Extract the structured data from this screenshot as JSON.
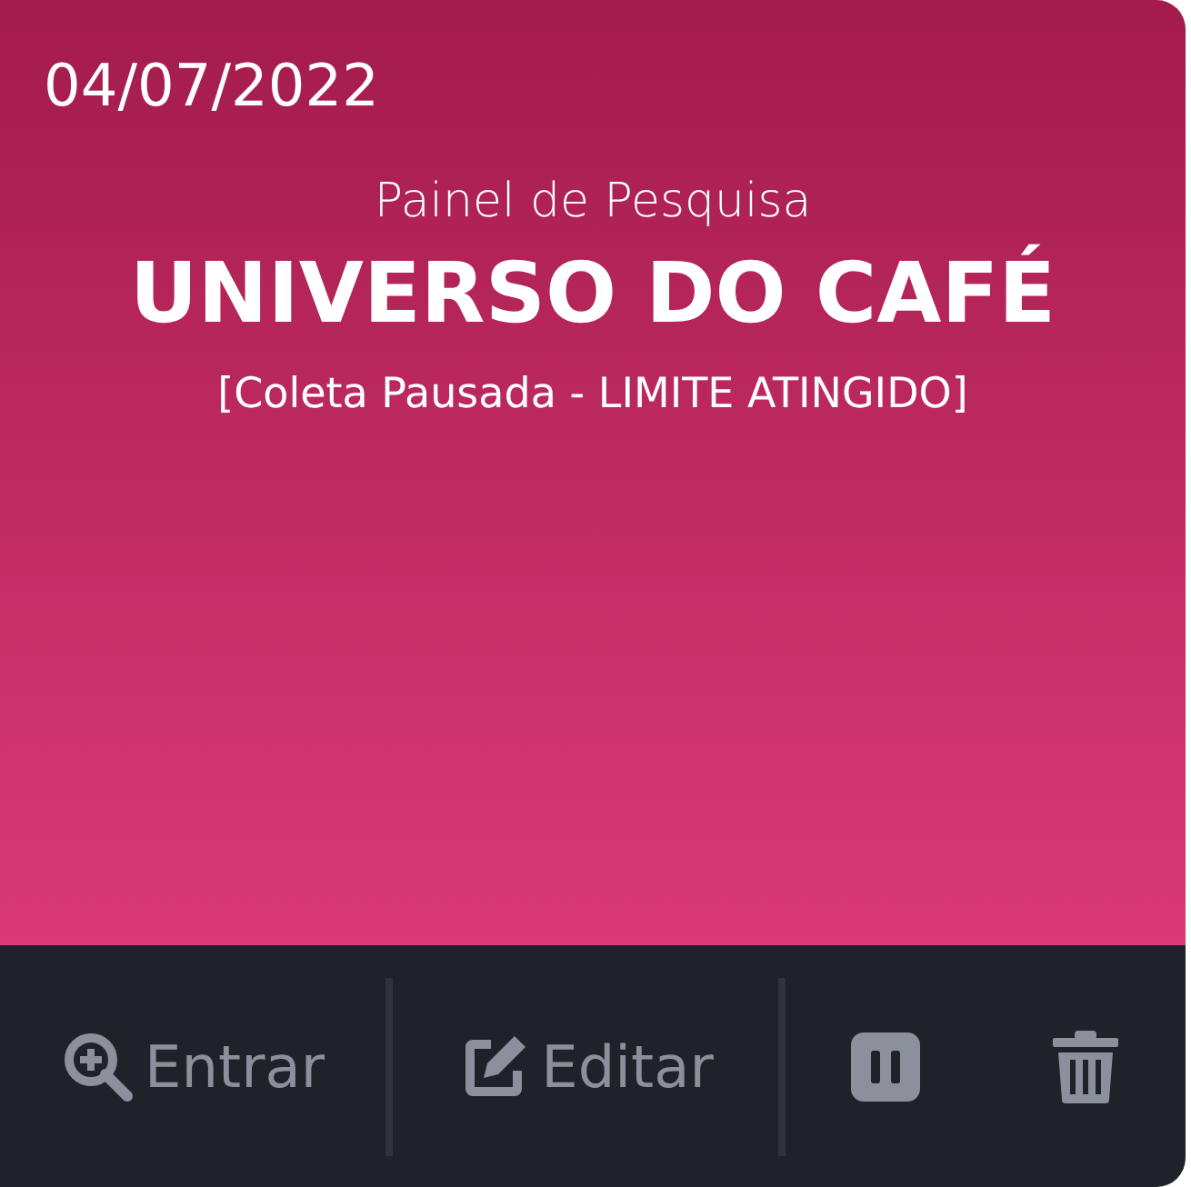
{
  "card": {
    "date": "04/07/2022",
    "subtitle": "Painel de Pesquisa",
    "title": "UNIVERSO DO CAFÉ",
    "status": "[Coleta Pausada - LIMITE ATINGIDO]"
  },
  "actions": [
    {
      "kind": "enter",
      "label": "Entrar"
    },
    {
      "kind": "edit",
      "label": "Editar"
    },
    {
      "kind": "pause"
    },
    {
      "kind": "delete"
    }
  ]
}
